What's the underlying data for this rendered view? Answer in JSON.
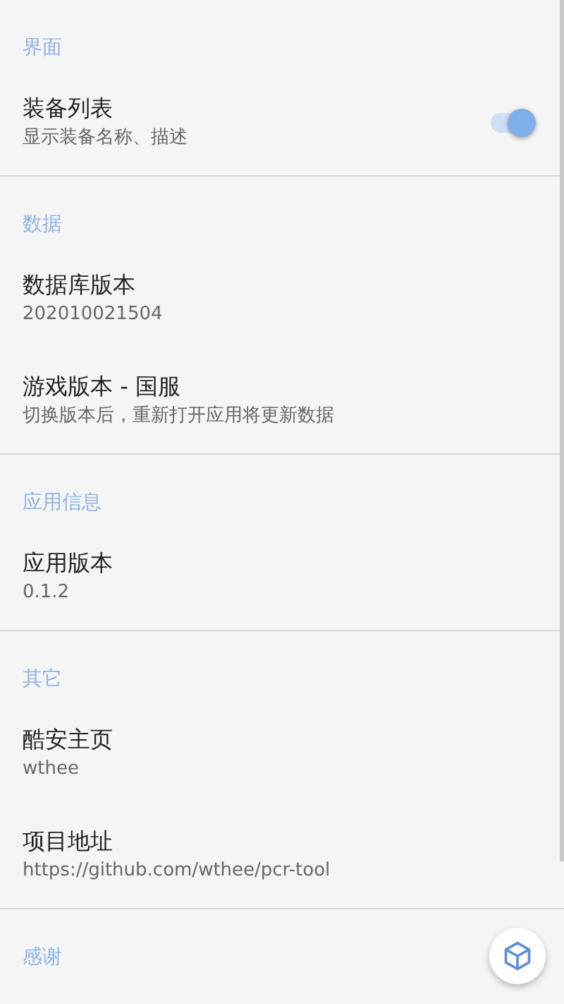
{
  "sections": [
    {
      "header": "界面",
      "items": [
        {
          "kind": "switch",
          "title": "装备列表",
          "summary": "显示装备名称、描述",
          "on": true
        }
      ]
    },
    {
      "header": "数据",
      "items": [
        {
          "kind": "text",
          "title": "数据库版本",
          "summary": "202010021504"
        },
        {
          "kind": "text",
          "title": "游戏版本 - 国服",
          "summary": "切换版本后，重新打开应用将更新数据"
        }
      ]
    },
    {
      "header": "应用信息",
      "items": [
        {
          "kind": "text",
          "title": "应用版本",
          "summary": "0.1.2"
        }
      ]
    },
    {
      "header": "其它",
      "items": [
        {
          "kind": "text",
          "title": "酷安主页",
          "summary": "wthee"
        },
        {
          "kind": "text",
          "title": "项目地址",
          "summary": "https://github.com/wthee/pcr-tool"
        }
      ]
    },
    {
      "header": "感谢"
    }
  ]
}
